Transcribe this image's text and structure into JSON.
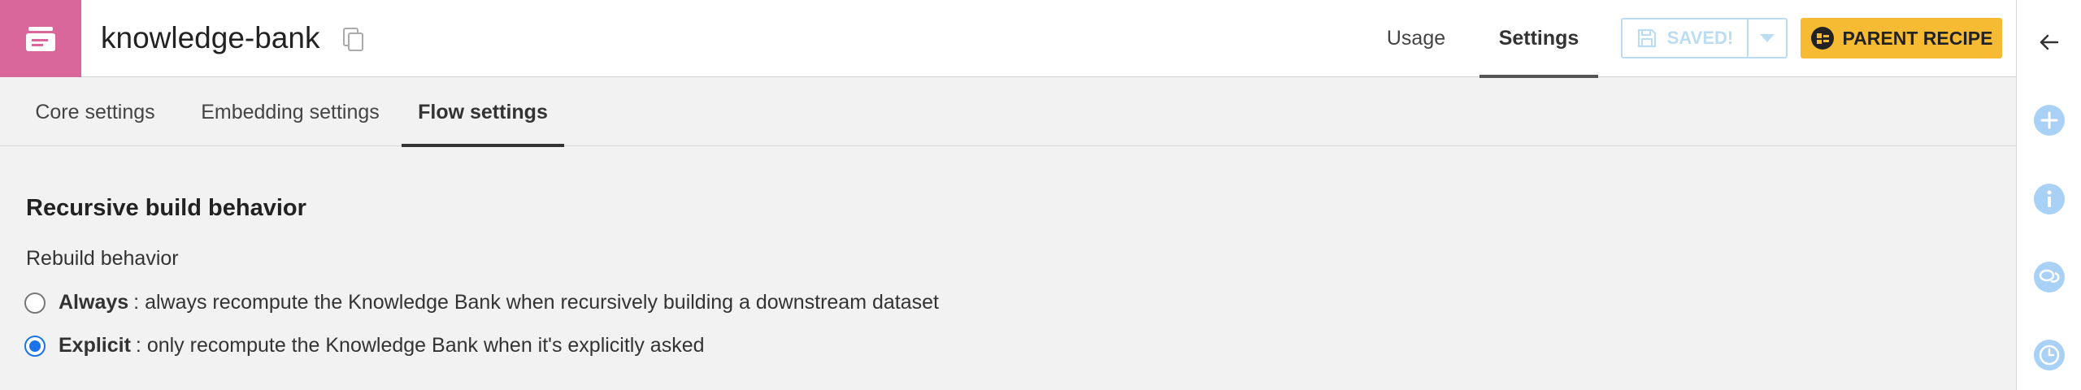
{
  "header": {
    "title": "knowledge-bank",
    "object_icon": "knowledge-bank-icon",
    "copy_icon": "copy-icon",
    "accent": "#d9679b",
    "tabs": [
      {
        "label": "Usage",
        "active": false
      },
      {
        "label": "Settings",
        "active": true
      }
    ],
    "save_label": "SAVED!",
    "parent_recipe_label": "PARENT RECIPE"
  },
  "subtabs": [
    {
      "label": "Core settings",
      "active": false
    },
    {
      "label": "Embedding settings",
      "active": false
    },
    {
      "label": "Flow settings",
      "active": true
    }
  ],
  "content": {
    "section_title": "Recursive build behavior",
    "field_label": "Rebuild behavior",
    "options": [
      {
        "name": "Always",
        "description": ": always recompute the Knowledge Bank when recursively building a downstream dataset",
        "selected": false
      },
      {
        "name": "Explicit",
        "description": ": only recompute the Knowledge Bank when it's explicitly asked",
        "selected": true
      }
    ]
  },
  "right_rail": {
    "items": [
      "back-arrow-icon",
      "add-icon",
      "info-icon",
      "discussion-icon",
      "history-icon"
    ],
    "icon_color": "#a9d1f5"
  }
}
